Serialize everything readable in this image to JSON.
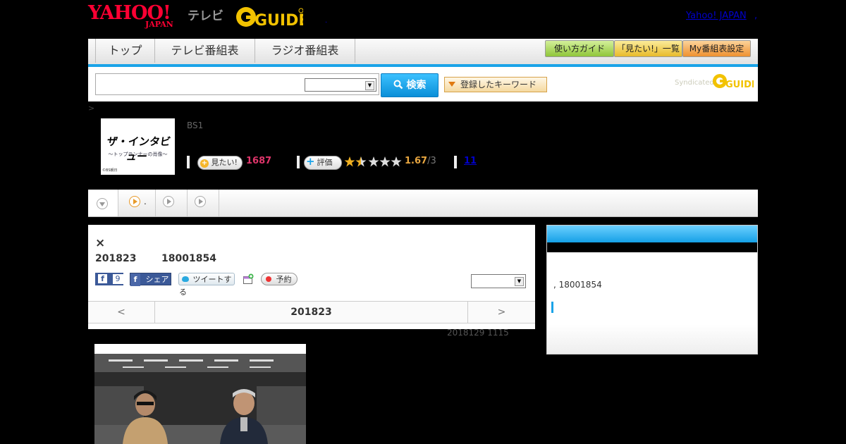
{
  "header": {
    "yahoo_logo": "YAHOO!",
    "japan_logo": "JAPAN",
    "tv_label": "テレビ",
    "gguide_logo": "GUIDE",
    "yahoo_japan_link": "Yahoo! JAPAN",
    "separator": ",",
    "dot": "."
  },
  "nav": {
    "tabs": [
      "トップ",
      "テレビ番組表",
      "ラジオ番組表"
    ],
    "buttons": [
      "使い方ガイド",
      "「見たい!」一覧",
      "My番組表設定"
    ],
    "colors": {
      "accent": "#1aa3e8",
      "guide_btn": "#a5d85a",
      "mitai_btn": "#f3cf4a",
      "my_btn": "#f5a54a"
    }
  },
  "search": {
    "search_button": "検索",
    "keyword_button": "登録したキーワード",
    "syndicated": "Syndicated",
    "syndicated_logo": "GUIDE"
  },
  "program": {
    "breadcrumb": ">",
    "thumbnail_title": "ザ・インタビュー",
    "thumbnail_subtitle": "〜トップランナーの肖像〜",
    "thumbnail_credit": "©BS朝日",
    "channel": "BS1",
    "mitai_label": "見たい!",
    "mitai_count": "1687",
    "rating_label": "評価",
    "rating": 1.67,
    "rating_text": "1.67",
    "rating_max": "/3",
    "comment_count": "11"
  },
  "subtabs": {
    "tab2_label": "."
  },
  "episode": {
    "close": "×",
    "date": "201823",
    "time": "18001854",
    "fb_count": "9",
    "share_label": "シェア",
    "tweet_label": "ツイートする",
    "reserve_label": "予約",
    "pager_prev": "<",
    "pager_date": "201823",
    "pager_next": ">",
    "updated": "2018129  1115"
  },
  "side": {
    "text": ", 18001854"
  }
}
